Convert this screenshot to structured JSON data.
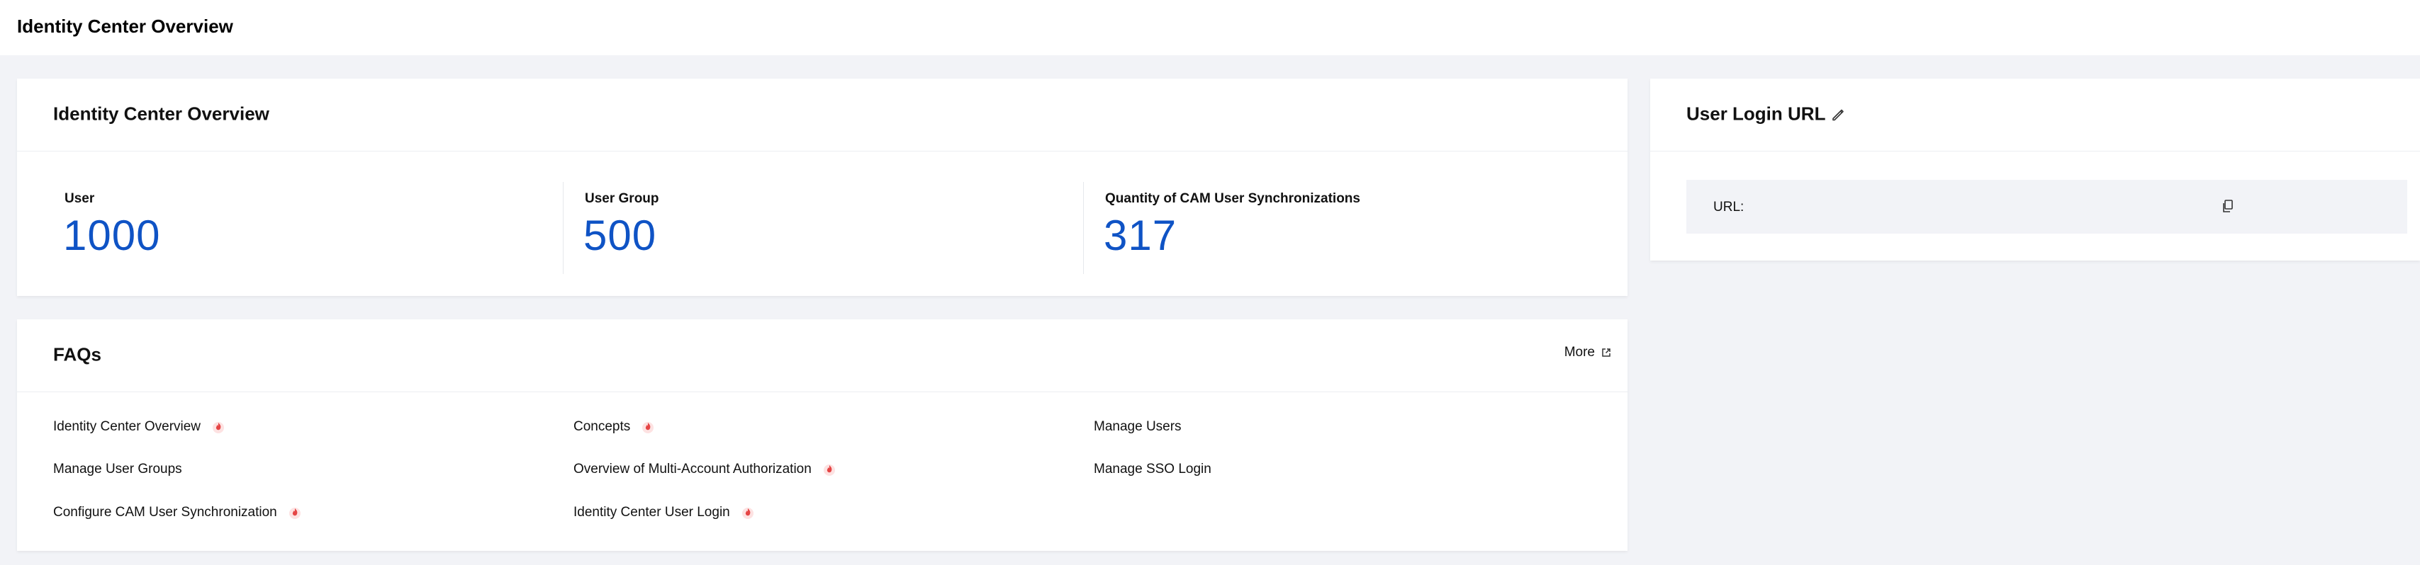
{
  "page": {
    "title": "Identity Center Overview"
  },
  "overview": {
    "title": "Identity Center Overview",
    "stats": [
      {
        "label": "User",
        "value": "1000"
      },
      {
        "label": "User Group",
        "value": "500"
      },
      {
        "label": "Quantity of CAM User Synchronizations",
        "value": "317"
      }
    ],
    "value_color": "#0f53c5"
  },
  "login": {
    "title": "User Login URL",
    "url_label": "URL:",
    "url_value": ""
  },
  "faqs": {
    "title": "FAQs",
    "more_label": "More",
    "items": [
      {
        "label": "Identity Center Overview",
        "hot": true
      },
      {
        "label": "Concepts",
        "hot": true
      },
      {
        "label": "Manage Users",
        "hot": false
      },
      {
        "label": "Manage User Groups",
        "hot": false
      },
      {
        "label": "Overview of Multi-Account Authorization",
        "hot": true
      },
      {
        "label": "Manage SSO Login",
        "hot": false
      },
      {
        "label": "Configure CAM User Synchronization",
        "hot": true
      },
      {
        "label": "Identity Center User Login",
        "hot": true
      }
    ],
    "hot_color": "#e54545"
  }
}
